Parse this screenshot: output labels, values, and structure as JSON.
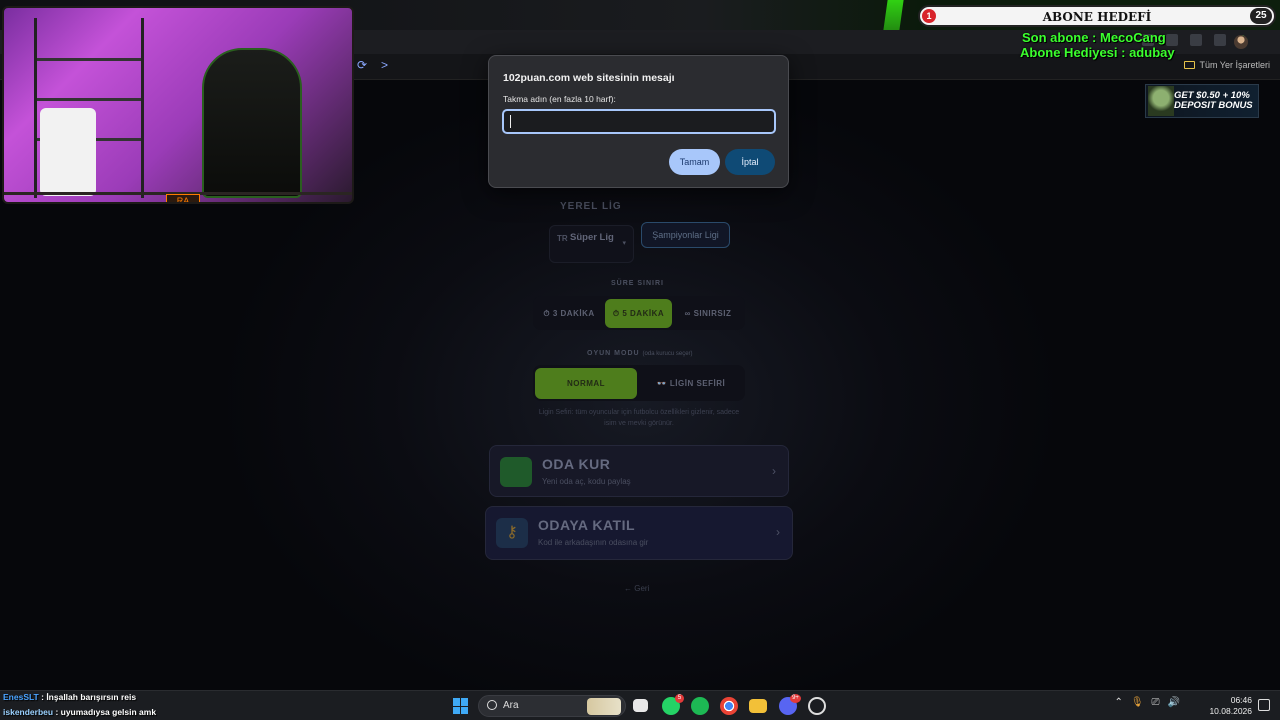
{
  "browser": {
    "bookmarks_label": "Tüm Yer İşaretleri"
  },
  "stream_overlay": {
    "goal_title": "ABONE HEDEFİ",
    "goal_current": "1",
    "goal_target": "25",
    "last_sub_label": "Son abone : MecoCang",
    "gift_sub_label": "Abone Hediyesi : adubay",
    "webcam_logo": "RA"
  },
  "ad": {
    "line1": "GET $0.50 + 10%",
    "line2": "DEPOSIT BONUS"
  },
  "dialog": {
    "title": "102puan.com web sitesinin mesajı",
    "prompt": "Takma adın (en fazla 10 harf):",
    "input_value": "",
    "ok_label": "Tamam",
    "cancel_label": "İptal"
  },
  "page": {
    "local_league_title": "YEREL LİG",
    "league_code": "TR",
    "league_option": "Süper Lig",
    "champions_label": "Şampiyonlar Ligi",
    "time_limit_title": "SÜRE SINIRI",
    "time_options": [
      "⏱ 3 DAKİKA",
      "⏱ 5 DAKİKA",
      "∞ SINIRSIZ"
    ],
    "game_mode_title": "OYUN MODU",
    "game_mode_note": "(oda kurucu seçer)",
    "mode_options": [
      "NORMAL",
      "👓 LİGİN SEFİRİ"
    ],
    "mode_description": "Ligin Sefiri: tüm oyuncular için futbolcu özellikleri gizlenir, sadece isim ve mevki görünür.",
    "create_room_title": "ODA KUR",
    "create_room_sub": "Yeni oda aç, kodu paylaş",
    "join_room_title": "ODAYA KATIL",
    "join_room_sub": "Kod ile arkadaşının odasına gir",
    "back_label": "← Geri"
  },
  "chat": [
    {
      "user": "EnesSLT",
      "message": "İnşallah barışırsın reis"
    },
    {
      "user": "iskenderbeu",
      "message": "uyumadıysa gelsin amk"
    }
  ],
  "taskbar": {
    "search_label": "Ara",
    "whatsapp_badge": "5",
    "discord_badge": "9+",
    "time": "06:46",
    "date": "10.08.2026"
  },
  "colors": {
    "accent_green": "#6fbf2a",
    "dialog_ok": "#a8c7fa",
    "dialog_cancel": "#0f4a75",
    "overlay_green": "#3bff2e"
  }
}
